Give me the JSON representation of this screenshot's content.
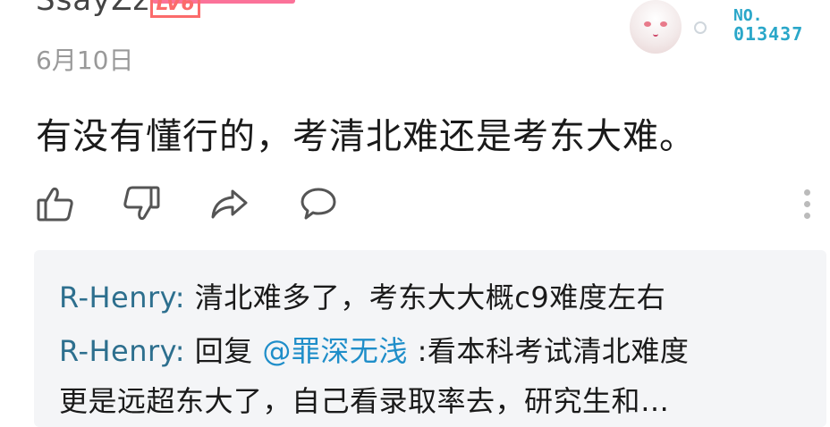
{
  "comment": {
    "username": "SsayZz",
    "level": "LV6",
    "date": "6月10日",
    "badge_no_label": "NO.",
    "badge_no_value": "013437",
    "text": "有没有懂行的，考清北难还是考东大难。"
  },
  "actions": {
    "like_icon": "thumb-up-icon",
    "dislike_icon": "thumb-down-icon",
    "share_icon": "share-icon",
    "reply_icon": "comment-icon",
    "more_icon": "more-vertical-icon"
  },
  "replies": [
    {
      "author": "R-Henry:",
      "text": " 清北难多了，考东大大概c9难度左右"
    },
    {
      "author": "R-Henry:",
      "prefix": " 回复 ",
      "mention": "@罪深无浅",
      "text": " :看本科考试清北难度",
      "text_cont": "更是远超东大了，自己看录取率去，研究生和…"
    }
  ],
  "colors": {
    "accent_pink": "#fb7299",
    "level_red": "#fb6b6b",
    "author_blue": "#2d6f8e",
    "mention_blue": "#1f8ec9",
    "badge_cyan": "#2aa7c9"
  }
}
